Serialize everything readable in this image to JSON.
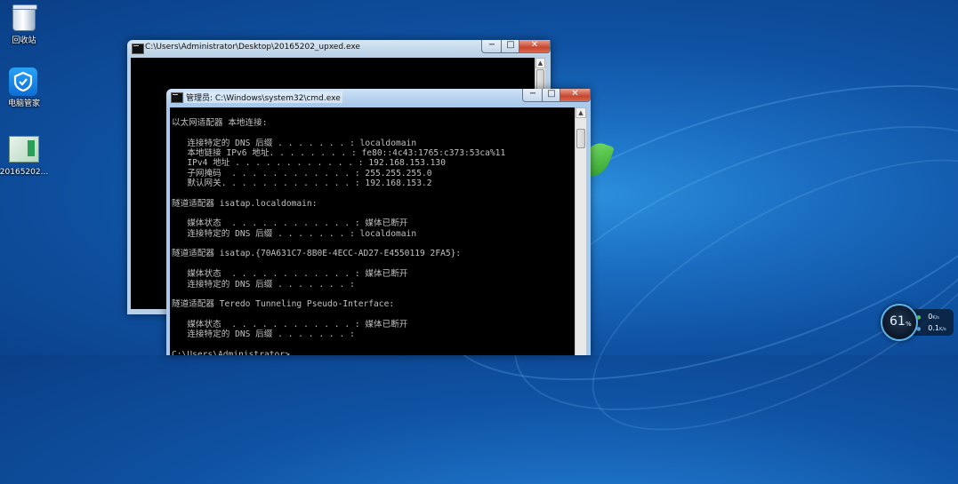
{
  "desktop": {
    "icons": [
      {
        "label": "回收站",
        "icon": "recycle-bin-icon"
      },
      {
        "label": "电脑管家",
        "icon": "tencent-pc-manager-icon"
      },
      {
        "label": "20165202...",
        "icon": "exe-file-icon"
      }
    ]
  },
  "back_window": {
    "title": "C:\\Users\\Administrator\\Desktop\\20165202_upxed.exe",
    "controls": {
      "minimize": "−",
      "maximize": "□",
      "close": "✕"
    }
  },
  "front_window": {
    "title": "管理员: C:\\Windows\\system32\\cmd.exe",
    "controls": {
      "minimize": "−",
      "maximize": "□",
      "close": "✕"
    },
    "lines": [
      "以太网适配器 本地连接:",
      "",
      "   连接特定的 DNS 后缀 . . . . . . . : localdomain",
      "   本地链接 IPv6 地址. . . . . . . . : fe80::4c43:1765:c373:53ca%11",
      "   IPv4 地址 . . . . . . . . . . . . : 192.168.153.130",
      "   子网掩码  . . . . . . . . . . . . : 255.255.255.0",
      "   默认网关. . . . . . . . . . . . . : 192.168.153.2",
      "",
      "隧道适配器 isatap.localdomain:",
      "",
      "   媒体状态  . . . . . . . . . . . . : 媒体已断开",
      "   连接特定的 DNS 后缀 . . . . . . . : localdomain",
      "",
      "隧道适配器 isatap.{70A631C7-8B0E-4ECC-AD27-E4550119 2FA5}:",
      "",
      "   媒体状态  . . . . . . . . . . . . : 媒体已断开",
      "   连接特定的 DNS 后缀 . . . . . . . :",
      "",
      "隧道适配器 Teredo Tunneling Pseudo-Interface:",
      "",
      "   媒体状态  . . . . . . . . . . . . : 媒体已断开",
      "   连接特定的 DNS 后缀 . . . . . . . :",
      "",
      "C:\\Users\\Administrator>"
    ]
  },
  "gadget": {
    "percent": "61",
    "unit": "%",
    "down_value": "0",
    "down_unit": "K/s",
    "up_value": "0.1",
    "up_unit": "K/s"
  }
}
